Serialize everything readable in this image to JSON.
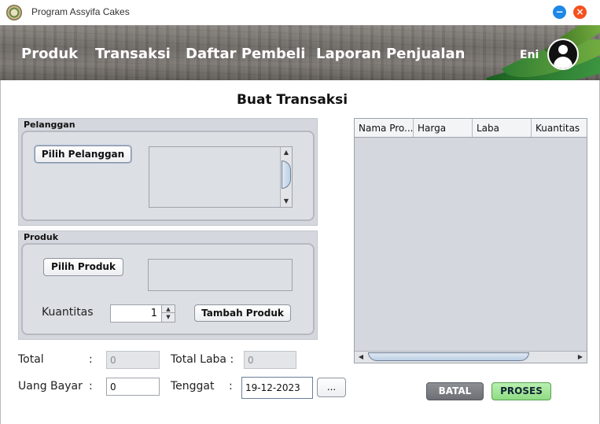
{
  "window": {
    "title": "Program Assyifa Cakes",
    "minimize_glyph": "−",
    "close_glyph": "×"
  },
  "nav": {
    "items": [
      "Produk",
      "Transaksi",
      "Daftar Pembeli",
      "Laporan Penjualan"
    ],
    "user_name": "Eni"
  },
  "page": {
    "title": "Buat Transaksi"
  },
  "pelanggan": {
    "group_title": "Pelanggan",
    "pick_button": "Pilih Pelanggan",
    "scroll_up": "▲",
    "scroll_down": "▼"
  },
  "produk": {
    "group_title": "Produk",
    "pick_button": "Pilih Produk",
    "quantity_label": "Kuantitas",
    "quantity_value": "1",
    "spin_up": "▲",
    "spin_down": "▼",
    "add_button": "Tambah Produk"
  },
  "summary": {
    "total_label": "Total",
    "colon": ":",
    "total_value": "0",
    "total_laba_label": "Total Laba :",
    "total_laba_value": "0",
    "uang_bayar_label": "Uang Bayar",
    "uang_bayar_value": "0",
    "tenggat_label": "Tenggat",
    "tenggat_value": "19-12-2023",
    "date_button": "..."
  },
  "table": {
    "columns": [
      "Nama Pro...",
      "Harga",
      "Laba",
      "Kuantitas"
    ],
    "rows": [],
    "scroll_left": "◀",
    "scroll_right": "▶"
  },
  "actions": {
    "cancel": "BATAL",
    "process": "PROSES"
  },
  "colors": {
    "cancel_bg": "#7a7d82",
    "process_bg": "#9ee495",
    "panel_bg": "#d4d7dd"
  }
}
